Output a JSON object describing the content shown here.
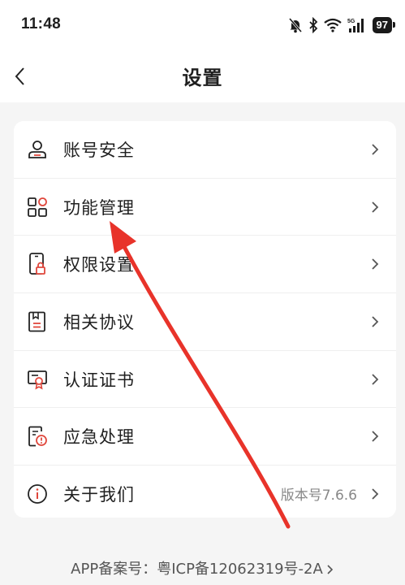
{
  "status_bar": {
    "time": "11:48",
    "battery": "97",
    "network": "5G"
  },
  "nav": {
    "title": "设置"
  },
  "menu": {
    "items": [
      {
        "label": "账号安全",
        "icon": "user-icon"
      },
      {
        "label": "功能管理",
        "icon": "grid-icon"
      },
      {
        "label": "权限设置",
        "icon": "phone-lock-icon"
      },
      {
        "label": "相关协议",
        "icon": "document-icon"
      },
      {
        "label": "认证证书",
        "icon": "certificate-icon"
      },
      {
        "label": "应急处理",
        "icon": "emergency-doc-icon"
      },
      {
        "label": "关于我们",
        "icon": "info-icon",
        "value": "版本号7.6.6"
      }
    ]
  },
  "footer": {
    "text": "APP备案号：粤ICP备12062319号-2A"
  },
  "colors": {
    "accent": "#e0473c",
    "annotation": "#e8332a",
    "background": "#f5f5f5"
  }
}
